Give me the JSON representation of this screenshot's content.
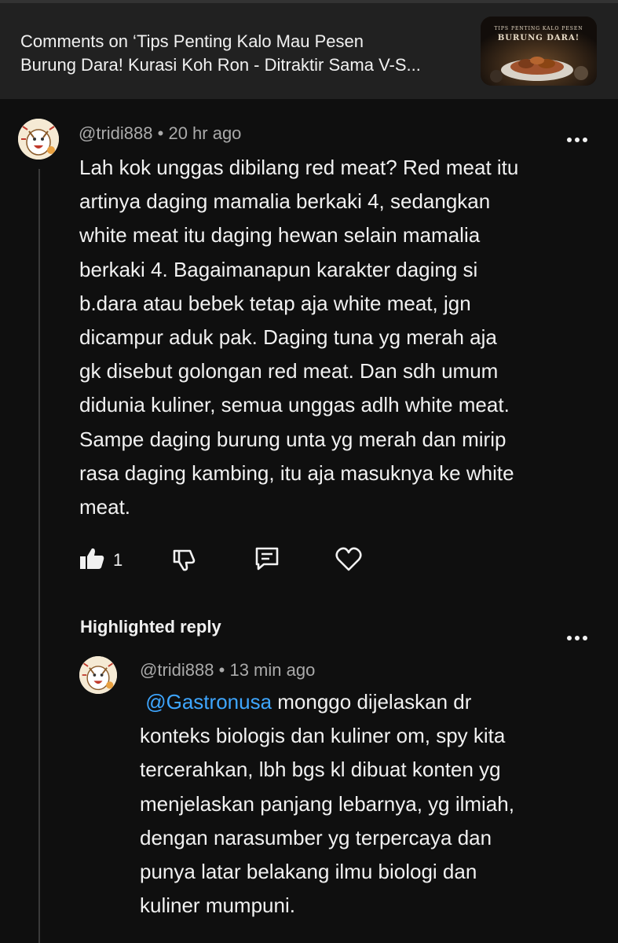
{
  "header": {
    "title_lines": [
      "Comments on ‘Tips Penting Kalo Mau Pesen",
      "Burung Dara! Kurasi Koh Ron - Ditraktir Sama V-S..."
    ],
    "thumbnail": {
      "text_top": "TIPS PENTING KALO PESEN",
      "text_main": "BURUNG DARA!"
    }
  },
  "comment": {
    "author": "@tridi888",
    "time": "20 hr ago",
    "lines": [
      "Lah kok unggas dibilang red meat? Red meat itu",
      "artinya daging mamalia berkaki 4, sedangkan",
      "white meat itu daging hewan selain mamalia",
      "berkaki 4. Bagaimanapun karakter daging si",
      "b.dara atau bebek tetap aja white meat, jgn",
      "dicampur aduk pak. Daging tuna yg merah aja",
      "gk disebut golongan red meat.  Dan sdh umum",
      "didunia kuliner, semua unggas adlh white meat.",
      "Sampe daging burung unta yg merah dan mirip",
      "rasa daging kambing, itu aja masuknya ke white",
      "meat."
    ],
    "likes": "1",
    "icons": [
      "thumbs-up-icon",
      "thumbs-down-icon",
      "comment-icon",
      "heart-icon",
      "more-icon"
    ]
  },
  "reply": {
    "section_label": "Highlighted reply",
    "author": "@tridi888",
    "time": "13 min ago",
    "mention": "@Gastronusa",
    "first_line_rest": " monggo dijelaskan dr",
    "lines": [
      "konteks biologis dan kuliner om, spy kita",
      "tercerahkan, lbh bgs kl dibuat konten yg",
      "menjelaskan panjang lebarnya, yg ilmiah,",
      "dengan narasumber yg terpercaya dan",
      "punya latar belakang ilmu biologi dan",
      "kuliner mumpuni."
    ]
  },
  "colors": {
    "background": "#0f0f0f",
    "header_bg": "#212121",
    "text_primary": "#f1f1f1",
    "text_secondary": "#aaaaaa",
    "mention": "#3ea6ff",
    "thread_line": "#3a3a3a"
  }
}
